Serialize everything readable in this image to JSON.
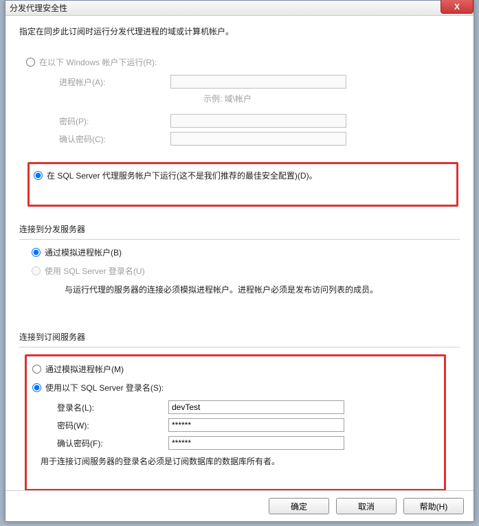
{
  "window": {
    "title": "分发代理安全性",
    "close_glyph": "X"
  },
  "instruction": "指定在同步此订阅时运行分发代理进程的域或计算机帐户。",
  "runAs": {
    "windows_radio": "在以下 Windows 帐户下运行(R):",
    "process_account_label": "进程帐户(A):",
    "example_text": "示例: 域\\帐户",
    "password_label": "密码(P):",
    "confirm_password_label": "确认密码(C):",
    "sqlagent_radio": "在 SQL Server 代理服务帐户下运行(这不是我们推荐的最佳安全配置)(D)。"
  },
  "distServer": {
    "section_label": "连接到分发服务器",
    "impersonate_radio": "通过模拟进程帐户(B)",
    "sqllogin_radio": "使用 SQL Server 登录名(U)",
    "hint": "与运行代理的服务器的连接必须模拟进程帐户。进程帐户必须是发布访问列表的成员。"
  },
  "subServer": {
    "section_label": "连接到订阅服务器",
    "impersonate_radio": "通过模拟进程帐户(M)",
    "sqllogin_radio": "使用以下 SQL Server 登录名(S):",
    "login_label": "登录名(L):",
    "login_value": "devTest",
    "password_label": "密码(W):",
    "password_value": "******",
    "confirm_label": "确认密码(F):",
    "confirm_value": "******",
    "hint": "用于连接订阅服务器的登录名必须是订阅数据库的数据库所有者。"
  },
  "buttons": {
    "ok": "确定",
    "cancel": "取消",
    "help": "帮助(H)"
  }
}
